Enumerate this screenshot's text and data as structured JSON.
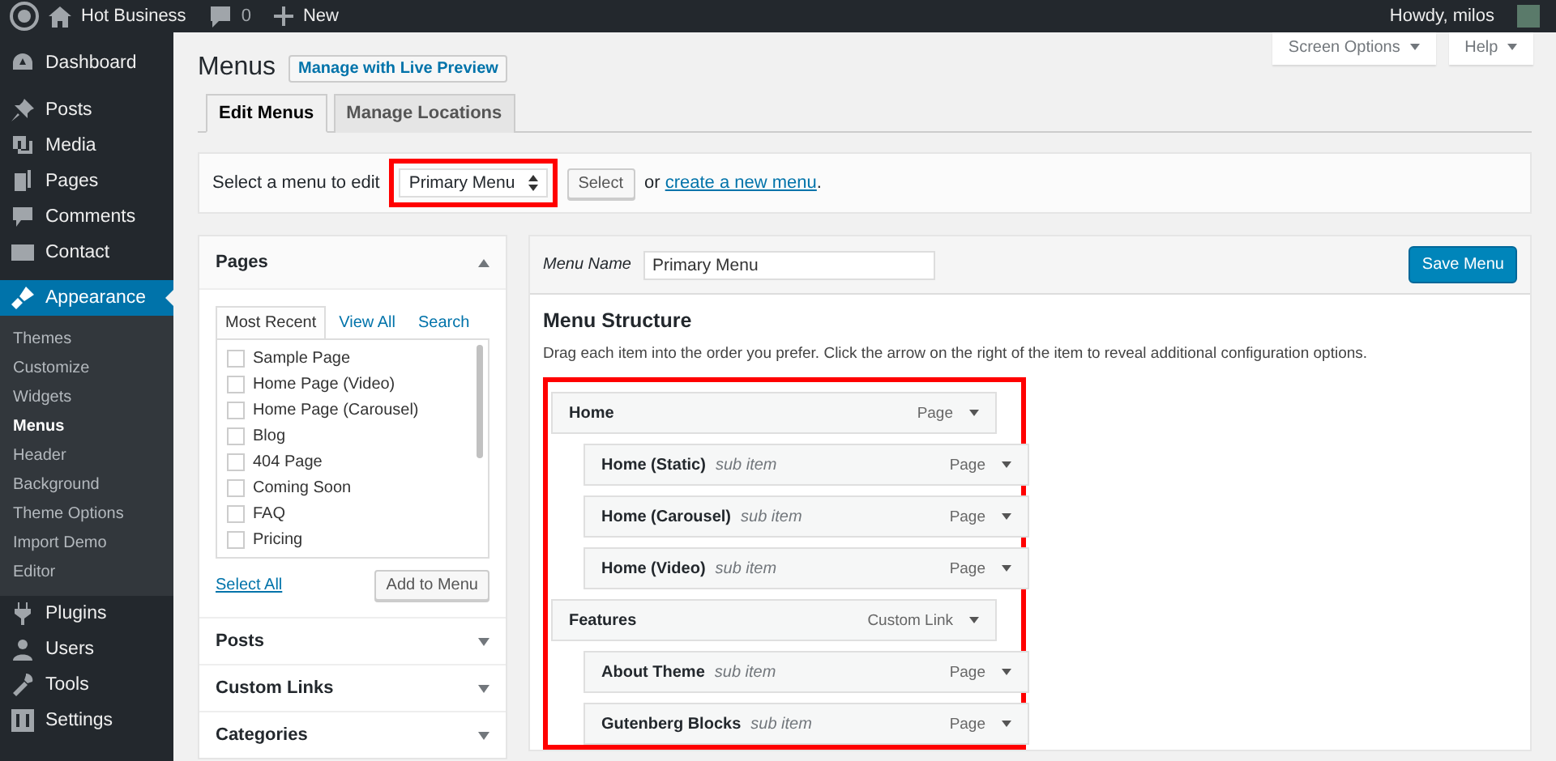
{
  "top_bar": {
    "site_name": "Hot Business",
    "comments_count": "0",
    "new_label": "New",
    "greeting": "Howdy, milos"
  },
  "sidebar": {
    "items": [
      {
        "label": "Dashboard",
        "selected": false
      },
      {
        "label": "Posts",
        "selected": false
      },
      {
        "label": "Media",
        "selected": false
      },
      {
        "label": "Pages",
        "selected": false
      },
      {
        "label": "Comments",
        "selected": false
      },
      {
        "label": "Contact",
        "selected": false
      },
      {
        "label": "Appearance",
        "selected": true,
        "children": [
          {
            "label": "Themes",
            "selected": false
          },
          {
            "label": "Customize",
            "selected": false
          },
          {
            "label": "Widgets",
            "selected": false
          },
          {
            "label": "Menus",
            "selected": true
          },
          {
            "label": "Header",
            "selected": false
          },
          {
            "label": "Background",
            "selected": false
          },
          {
            "label": "Theme Options",
            "selected": false
          },
          {
            "label": "Import Demo",
            "selected": false
          },
          {
            "label": "Editor",
            "selected": false
          }
        ]
      },
      {
        "label": "Plugins",
        "selected": false
      },
      {
        "label": "Users",
        "selected": false
      },
      {
        "label": "Tools",
        "selected": false
      },
      {
        "label": "Settings",
        "selected": false
      }
    ]
  },
  "screen_meta": {
    "buttons": [
      "Screen Options",
      "Help"
    ]
  },
  "page": {
    "title": "Menus",
    "live_preview_button": "Manage with Live Preview",
    "tabs": [
      {
        "label": "Edit Menus",
        "selected": true
      },
      {
        "label": "Manage Locations",
        "selected": false
      }
    ]
  },
  "menu_select": {
    "label": "Select a menu to edit",
    "value": "Primary Menu",
    "highlighted": true,
    "select_button": "Select",
    "or_text": "or",
    "create_link": "create a new menu",
    "period": "."
  },
  "pages_box": {
    "title": "Pages",
    "expanded": true,
    "tabs": [
      {
        "label": "Most Recent",
        "selected": true
      },
      {
        "label": "View All",
        "selected": false
      },
      {
        "label": "Search",
        "selected": false
      }
    ],
    "items": [
      {
        "label": "Sample Page",
        "checked": false
      },
      {
        "label": "Home Page (Video)",
        "checked": false
      },
      {
        "label": "Home Page (Carousel)",
        "checked": false
      },
      {
        "label": "Blog",
        "checked": false
      },
      {
        "label": "404 Page",
        "checked": false
      },
      {
        "label": "Coming Soon",
        "checked": false
      },
      {
        "label": "FAQ",
        "checked": false
      },
      {
        "label": "Pricing",
        "checked": false
      }
    ],
    "select_all": "Select All",
    "add_button": "Add to Menu"
  },
  "other_boxes": [
    {
      "title": "Posts",
      "expanded": false
    },
    {
      "title": "Custom Links",
      "expanded": false
    },
    {
      "title": "Categories",
      "expanded": false
    }
  ],
  "menu_editor": {
    "name_label": "Menu Name",
    "name_value": "Primary Menu",
    "save_button": "Save Menu",
    "heading": "Menu Structure",
    "instructions": "Drag each item into the order you prefer. Click the arrow on the right of the item to reveal additional configuration options.",
    "highlighted": true,
    "items": [
      {
        "title": "Home",
        "type": "Page",
        "children": [
          {
            "title": "Home (Static)",
            "note": "sub item",
            "type": "Page"
          },
          {
            "title": "Home (Carousel)",
            "note": "sub item",
            "type": "Page"
          },
          {
            "title": "Home (Video)",
            "note": "sub item",
            "type": "Page"
          }
        ]
      },
      {
        "title": "Features",
        "type": "Custom Link",
        "children": [
          {
            "title": "About Theme",
            "note": "sub item",
            "type": "Page"
          },
          {
            "title": "Gutenberg Blocks",
            "note": "sub item",
            "type": "Page"
          }
        ]
      }
    ]
  }
}
